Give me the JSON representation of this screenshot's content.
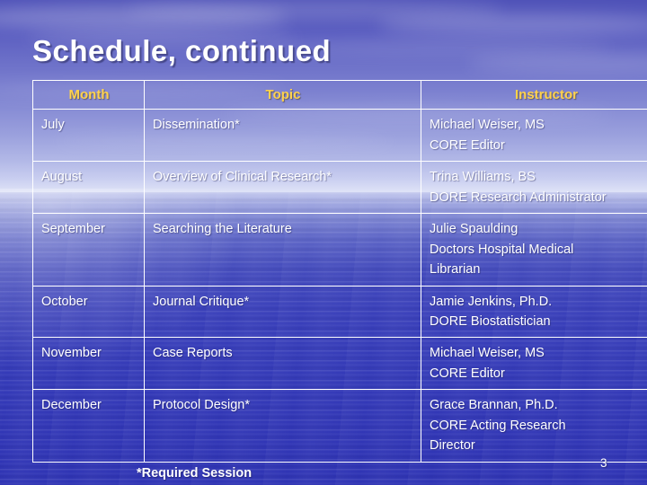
{
  "slide": {
    "title": "Schedule, continued",
    "page_number": "3",
    "footnote": "*Required Session",
    "background": {
      "theme": "ocean-sky",
      "sky_color": "#6e72c9",
      "sea_color": "#3a40ba",
      "horizon_color": "#c3c8ee"
    },
    "colors": {
      "header_text": "#ffd24d",
      "body_text": "#ffffff",
      "border": "#ffffff",
      "title_text": "#ffffff"
    }
  },
  "table": {
    "headers": [
      "Month",
      "Topic",
      "Instructor"
    ],
    "rows": [
      {
        "month": "July",
        "topic": "Dissemination*",
        "instructor_lines": [
          "Michael Weiser, MS",
          "CORE Editor"
        ]
      },
      {
        "month": "August",
        "topic": "Overview of Clinical Research*",
        "instructor_lines": [
          "Trina Williams, BS",
          "DORE Research Administrator"
        ]
      },
      {
        "month": "September",
        "topic": "Searching the Literature",
        "instructor_lines": [
          "Julie Spaulding",
          "Doctors Hospital Medical",
          "Librarian"
        ]
      },
      {
        "month": "October",
        "topic": "Journal Critique*",
        "instructor_lines": [
          "Jamie Jenkins, Ph.D.",
          "DORE Biostatistician"
        ]
      },
      {
        "month": "November",
        "topic": "Case Reports",
        "instructor_lines": [
          "Michael Weiser, MS",
          "CORE Editor"
        ]
      },
      {
        "month": "December",
        "topic": "Protocol Design*",
        "instructor_lines": [
          "Grace Brannan, Ph.D.",
          "CORE Acting Research",
          "Director"
        ]
      }
    ]
  }
}
